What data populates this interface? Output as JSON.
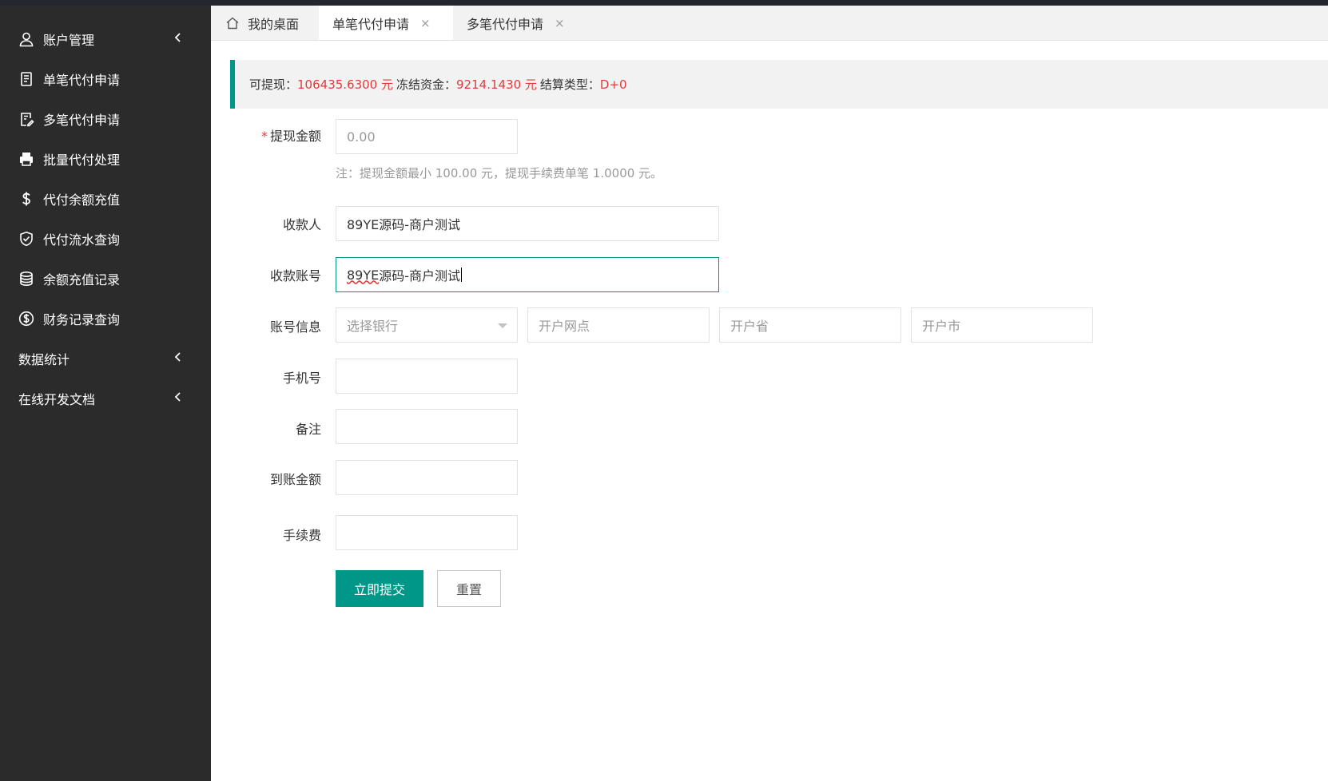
{
  "sidebar": {
    "items": [
      {
        "label": "账户管理",
        "icon": "user-icon",
        "chevron": true
      },
      {
        "label": "单笔代付申请",
        "icon": "document-icon",
        "chevron": false
      },
      {
        "label": "多笔代付申请",
        "icon": "document-edit-icon",
        "chevron": false
      },
      {
        "label": "批量代付处理",
        "icon": "printer-icon",
        "chevron": false
      },
      {
        "label": "代付余额充值",
        "icon": "dollar-icon",
        "chevron": false
      },
      {
        "label": "代付流水查询",
        "icon": "shield-check-icon",
        "chevron": false
      },
      {
        "label": "余额充值记录",
        "icon": "database-icon",
        "chevron": false
      },
      {
        "label": "财务记录查询",
        "icon": "dollar-circle-icon",
        "chevron": false
      },
      {
        "label": "数据统计",
        "icon": "",
        "chevron": true
      },
      {
        "label": "在线开发文档",
        "icon": "",
        "chevron": true
      }
    ]
  },
  "tabs": [
    {
      "label": "我的桌面",
      "icon": "home-icon",
      "closable": false,
      "active": false
    },
    {
      "label": "单笔代付申请",
      "closable": true,
      "active": true
    },
    {
      "label": "多笔代付申请",
      "closable": true,
      "active": false
    }
  ],
  "close_glyph": "×",
  "balance": {
    "withdrawable_label": "可提现：",
    "withdrawable_value": "106435.6300 元",
    "frozen_label": "冻结资金：",
    "frozen_value": "9214.1430 元",
    "settle_label": "结算类型：",
    "settle_value": "D+0"
  },
  "form": {
    "required_mark": "*",
    "amount_label": "提现金额",
    "amount_placeholder": "0.00",
    "amount_hint": "注：提现金额最小 100.00 元，提现手续费单笔 1.0000 元。",
    "payee_label": "收款人",
    "payee_value": "89YE源码-商户测试",
    "account_label": "收款账号",
    "account_value_underlined": "89YE",
    "account_value_rest": "源码-商户测试",
    "bankinfo_label": "账号信息",
    "bank_select_placeholder": "选择银行",
    "branch_placeholder": "开户网点",
    "province_placeholder": "开户省",
    "city_placeholder": "开户市",
    "phone_label": "手机号",
    "remark_label": "备注",
    "arrival_label": "到账金额",
    "fee_label": "手续费",
    "submit_label": "立即提交",
    "reset_label": "重置"
  },
  "colors": {
    "accent": "#009688",
    "sidebar_bg": "#2b2b2b",
    "highlight_red": "#e4393c"
  }
}
